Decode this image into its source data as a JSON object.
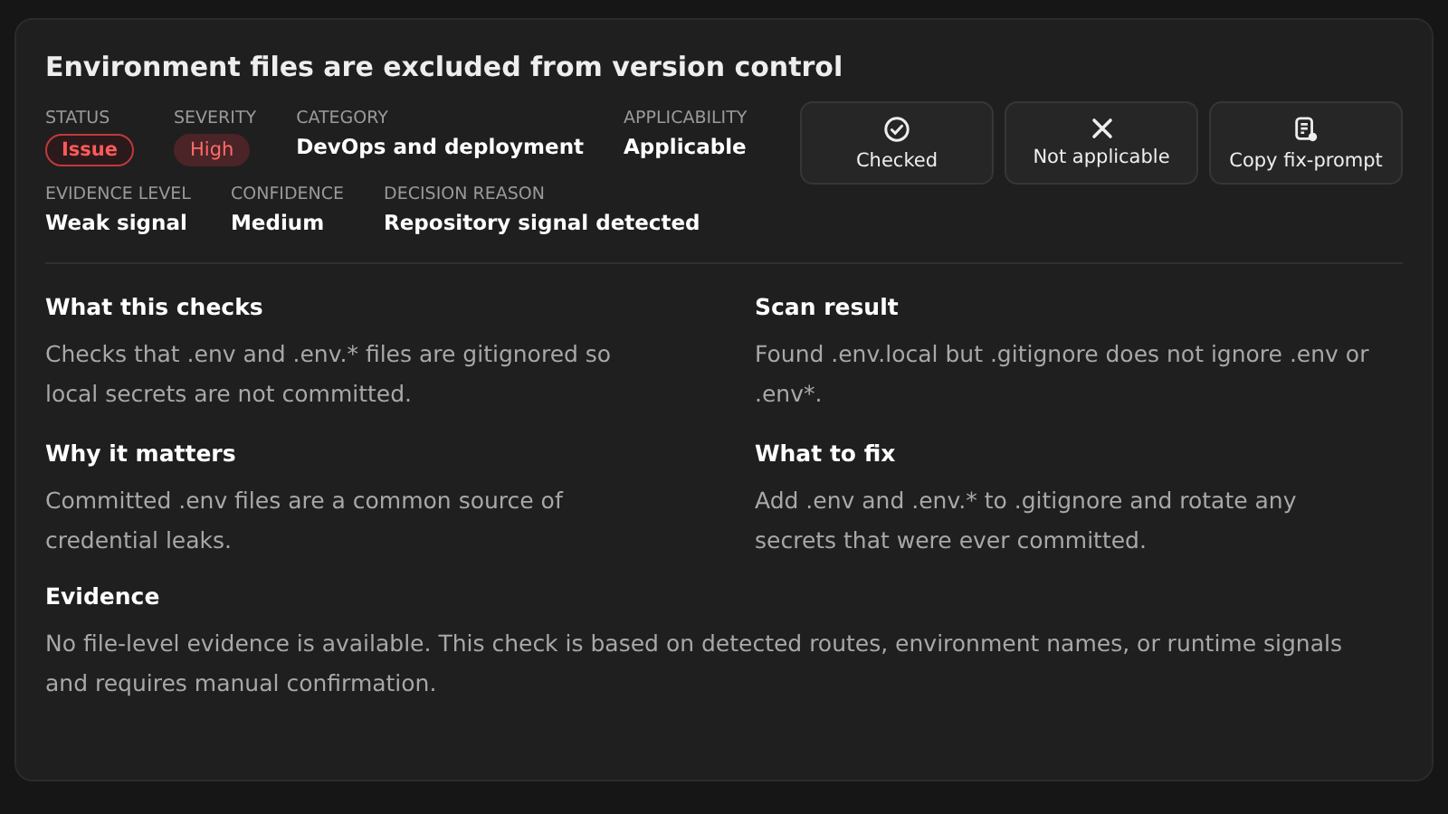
{
  "title": "Environment files are excluded from version control",
  "meta_rows": [
    [
      {
        "label": "STATUS",
        "value": "Issue",
        "kind": "outline-badge"
      },
      {
        "label": "SEVERITY",
        "value": "High",
        "kind": "filled-badge"
      },
      {
        "label": "CATEGORY",
        "value": "DevOps and deployment",
        "kind": "text"
      },
      {
        "label": "APPLICABILITY",
        "value": "Applicable",
        "kind": "text"
      }
    ],
    [
      {
        "label": "EVIDENCE LEVEL",
        "value": "Weak signal",
        "kind": "text"
      },
      {
        "label": "CONFIDENCE",
        "value": "Medium",
        "kind": "text"
      },
      {
        "label": "DECISION REASON",
        "value": "Repository signal detected",
        "kind": "text"
      }
    ]
  ],
  "actions": [
    {
      "label": "Checked",
      "kind": "confirm"
    },
    {
      "label": "Not applicable",
      "kind": "dismiss"
    },
    {
      "label": "Copy fix-prompt",
      "kind": "copy"
    }
  ],
  "sections": [
    {
      "heading": "What this checks",
      "body": "Checks that .env and .env.* files are gitignored so local secrets are not committed."
    },
    {
      "heading": "Scan result",
      "body": "Found .env.local but .gitignore does not ignore .env or .env*."
    },
    {
      "heading": "Why it matters",
      "body": "Committed .env files are a common source of credential leaks."
    },
    {
      "heading": "What to fix",
      "body": "Add .env and .env.* to .gitignore and rotate any secrets that were ever committed."
    }
  ],
  "evidence": {
    "heading": "Evidence",
    "body": "No file-level evidence is available. This check is based on detected routes, environment names, or runtime signals and requires manual confirmation."
  }
}
